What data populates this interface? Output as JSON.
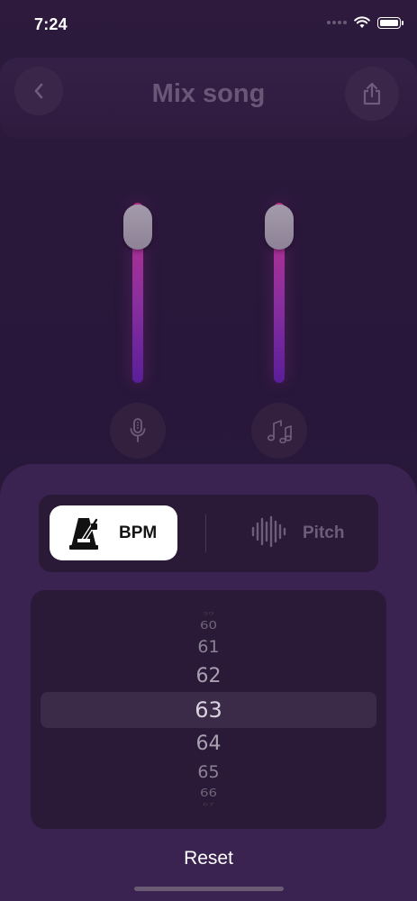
{
  "status_bar": {
    "time": "7:24"
  },
  "header": {
    "title": "Mix song"
  },
  "mixer": {
    "mic_level": 0.95,
    "music_level": 0.95
  },
  "segmented": {
    "options": [
      {
        "label": "BPM",
        "icon": "metronome-icon",
        "selected": true
      },
      {
        "label": "Pitch",
        "icon": "waveform-icon",
        "selected": false
      }
    ]
  },
  "picker": {
    "values": [
      "59",
      "60",
      "61",
      "62",
      "63",
      "64",
      "65",
      "66",
      "67"
    ],
    "selected": "63"
  },
  "reset_label": "Reset",
  "colors": {
    "background": "#2a1937",
    "sheet": "#3a2350",
    "slider_top": "#c0308e",
    "slider_bottom": "#5a1e9a",
    "selected_segment": "#ffffff"
  }
}
